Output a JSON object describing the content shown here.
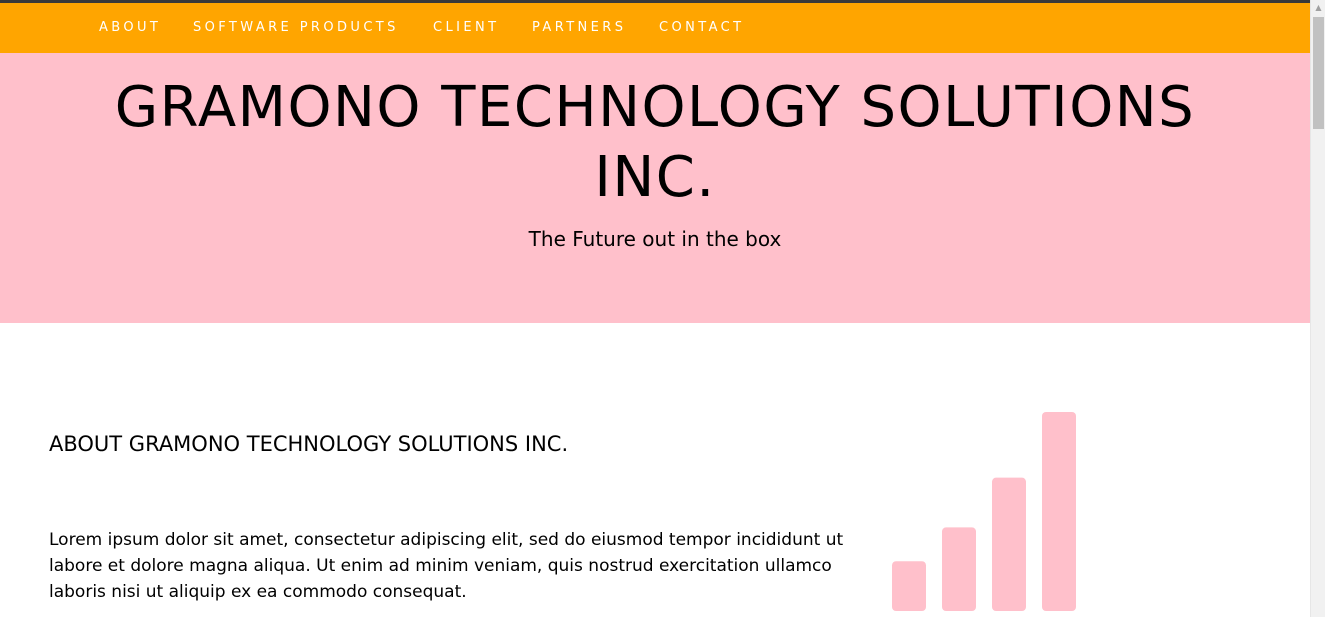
{
  "nav": {
    "items": [
      {
        "label": "ABOUT"
      },
      {
        "label": "SOFTWARE PRODUCTS"
      },
      {
        "label": "CLIENT"
      },
      {
        "label": "PARTNERS"
      },
      {
        "label": "CONTACT"
      }
    ]
  },
  "hero": {
    "title_line1": "GRAMONO TECHNOLOGY SOLUTIONS",
    "title_line2": "INC.",
    "subtitle": "The Future out in the box"
  },
  "about": {
    "heading": "ABOUT GRAMONO TECHNOLOGY SOLUTIONS INC.",
    "text": "Lorem ipsum dolor sit amet, consectetur adipiscing elit, sed do eiusmod tempor incididunt ut labore et dolore magna aliqua. Ut enim ad minim veniam, quis nostrud exercitation ullamco laboris nisi ut aliquip ex ea commodo consequat."
  },
  "graphic": {
    "icon": "signal-bars-icon",
    "color": "#ffc0cb",
    "levels": [
      0.25,
      0.42,
      0.67,
      1.0
    ]
  },
  "colors": {
    "nav_background": "#ffa500",
    "hero_background": "#ffc0cb",
    "nav_text": "#ffffff",
    "body_background": "#ffffff"
  }
}
